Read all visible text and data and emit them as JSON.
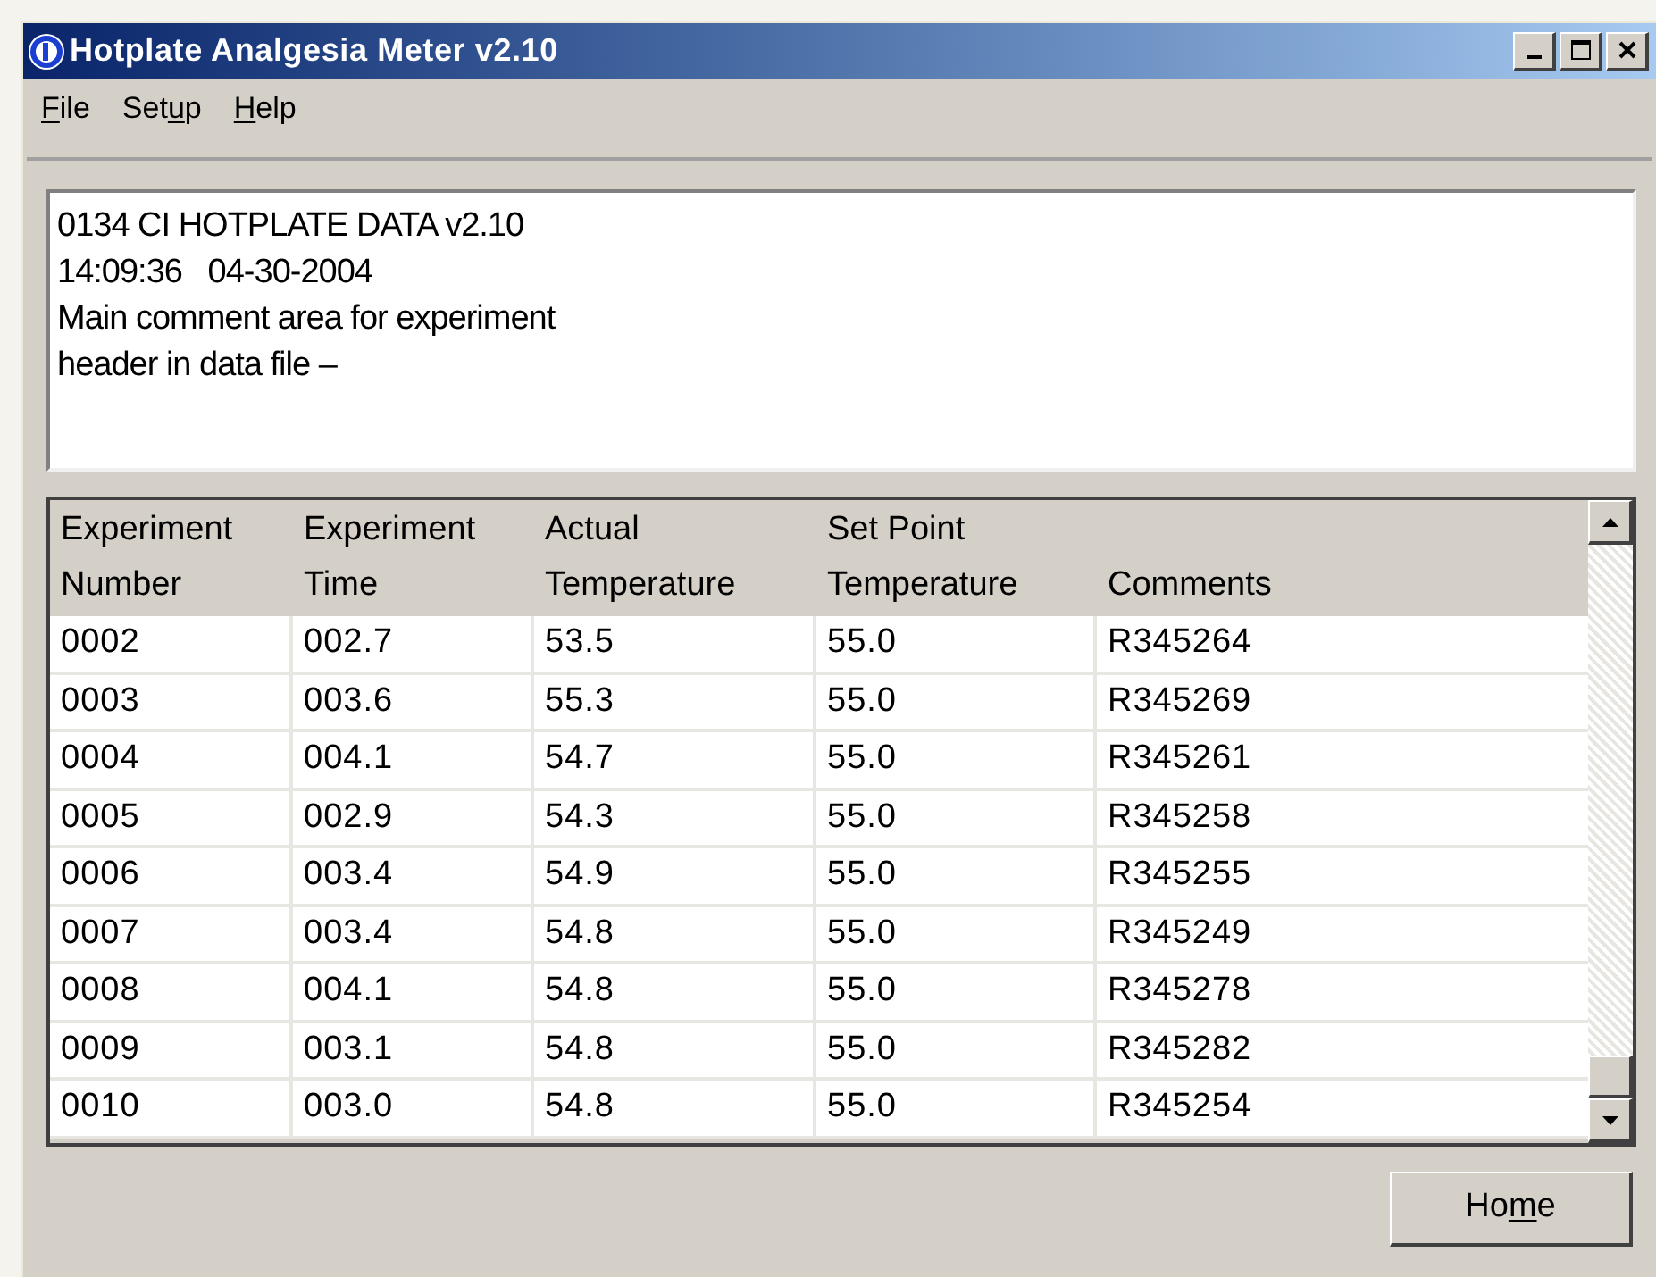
{
  "window": {
    "title": "Hotplate Analgesia Meter v2.10"
  },
  "menu": [
    {
      "key": "F",
      "post": "ile"
    },
    {
      "pre": "Set",
      "key": "u",
      "post": "p"
    },
    {
      "key": "H",
      "post": "elp"
    }
  ],
  "comment_box": {
    "lines": [
      "0134 CI HOTPLATE DATA v2.10",
      "14:09:36   04-30-2004",
      "Main comment area for experiment",
      "header in data file –"
    ]
  },
  "table": {
    "columns": [
      "Experiment\nNumber",
      "Experiment\nTime",
      "Actual\nTemperature",
      "Set Point\nTemperature",
      "Comments"
    ],
    "rows": [
      [
        "0002",
        "002.7",
        "53.5",
        "55.0",
        "R345264"
      ],
      [
        "0003",
        "003.6",
        "55.3",
        "55.0",
        "R345269"
      ],
      [
        "0004",
        "004.1",
        "54.7",
        "55.0",
        "R345261"
      ],
      [
        "0005",
        "002.9",
        "54.3",
        "55.0",
        "R345258"
      ],
      [
        "0006",
        "003.4",
        "54.9",
        "55.0",
        "R345255"
      ],
      [
        "0007",
        "003.4",
        "54.8",
        "55.0",
        "R345249"
      ],
      [
        "0008",
        "004.1",
        "54.8",
        "55.0",
        "R345278"
      ],
      [
        "0009",
        "003.1",
        "54.8",
        "55.0",
        "R345282"
      ],
      [
        "0010",
        "003.0",
        "54.8",
        "55.0",
        "R345254"
      ]
    ]
  },
  "home_button": {
    "pre": "Ho",
    "key": "m",
    "post": "e"
  }
}
